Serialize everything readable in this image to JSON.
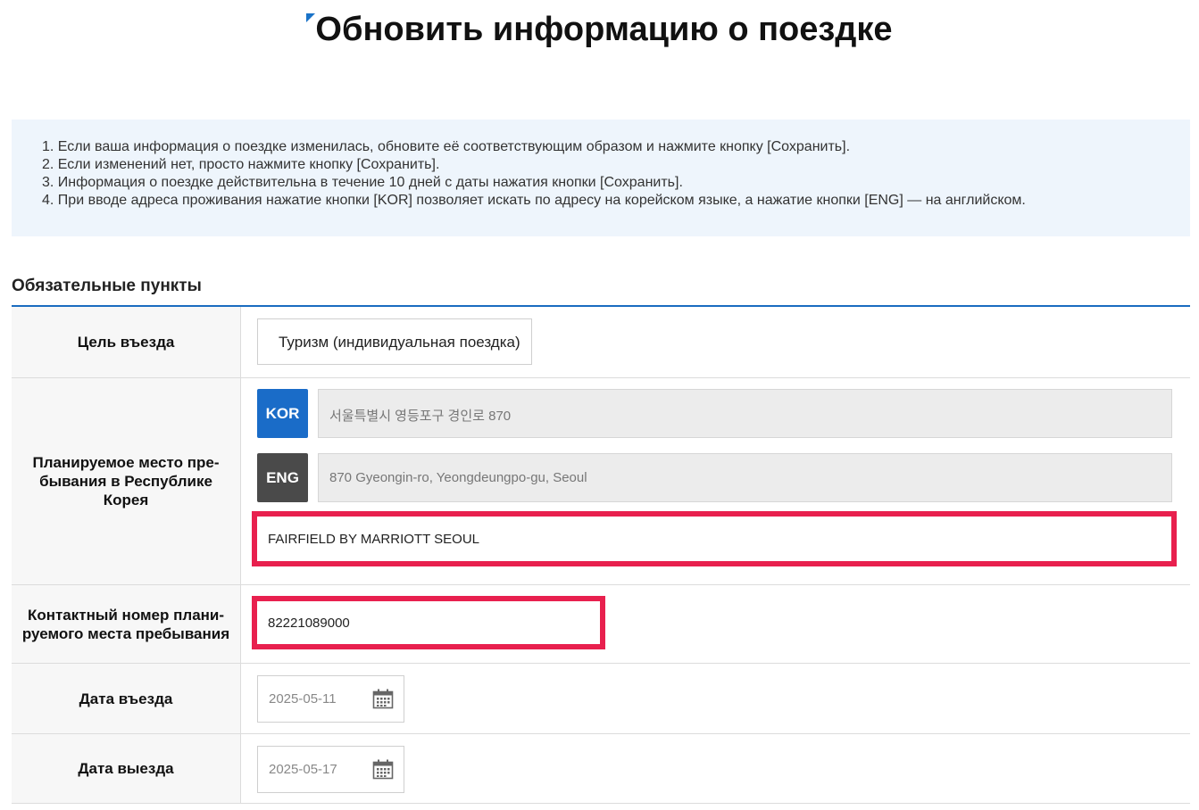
{
  "title": "Обновить информацию о поездке",
  "notice": {
    "items": [
      "1. Если ваша информация о поездке изменилась, обновите её соответствующим образом и нажмите кнопку [Сохранить].",
      "2. Если изменений нет, просто нажмите кнопку [Сохранить].",
      "3. Информация о поездке действительна в течение 10 дней с даты нажатия кнопки [Сохранить].",
      "4. При вводе адреса проживания нажатие кнопки [KOR] позволяет искать по адресу на корейском языке, а нажатие кнопки [ENG] — на английском."
    ]
  },
  "section_title": "Обязательные пункты",
  "form": {
    "purpose": {
      "label": "Цель въезда",
      "value": "Туризм (индивидуальная поездка)"
    },
    "stay": {
      "label": "Планируемое место пре-бывания в Республике Корея",
      "kor_button": "KOR",
      "eng_button": "ENG",
      "kor_address": "서울특별시 영등포구 경인로 870",
      "eng_address": "870 Gyeongin-ro, Yeongdeungpo-gu, Seoul",
      "detail_address": "FAIRFIELD BY MARRIOTT SEOUL"
    },
    "phone": {
      "label": "Контактный номер плани-руемого места пребывания",
      "value": "82221089000"
    },
    "entry_date": {
      "label": "Дата въезда",
      "value": "2025-05-11"
    },
    "exit_date": {
      "label": "Дата выезда",
      "value": "2025-05-17"
    }
  },
  "colors": {
    "accent": "#1a6cc8",
    "highlight": "#e8204e",
    "notice_bg": "#eef5fc",
    "eng_button": "#4a4a4a"
  }
}
